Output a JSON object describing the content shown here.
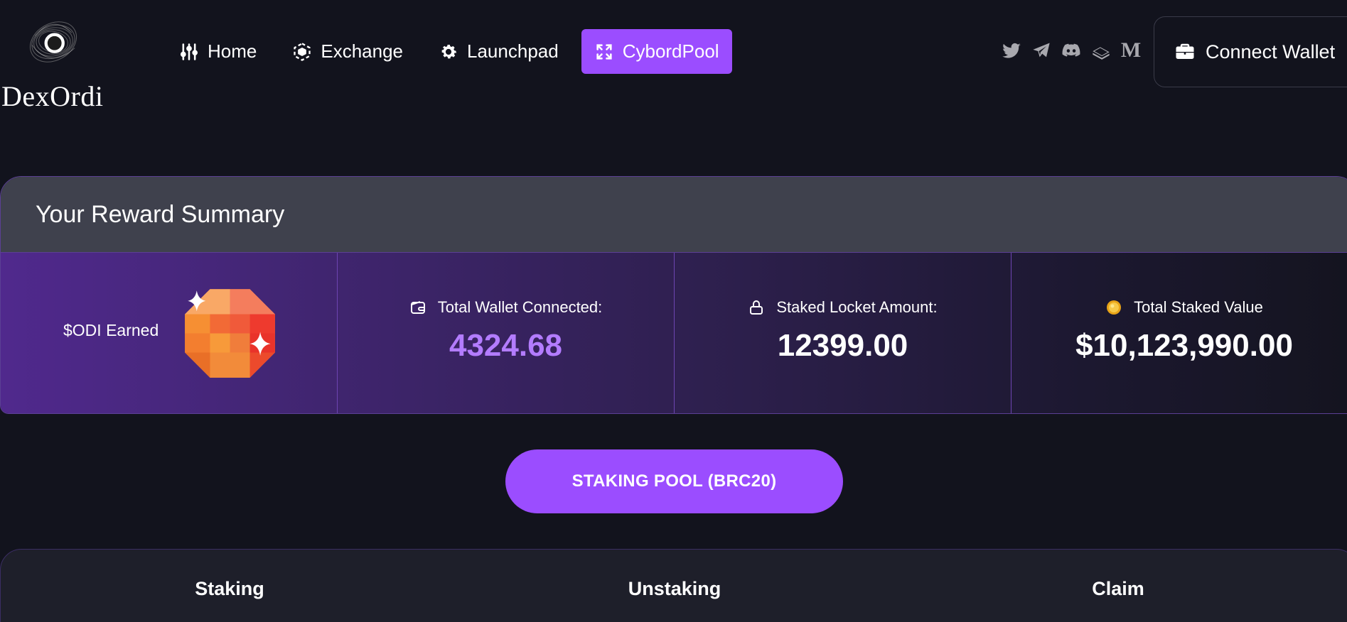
{
  "brand": {
    "name": "DexOrdi"
  },
  "nav": {
    "items": [
      {
        "label": "Home",
        "icon": "sliders-icon",
        "active": false
      },
      {
        "label": "Exchange",
        "icon": "cube-icon",
        "active": false
      },
      {
        "label": "Launchpad",
        "icon": "gear-icon",
        "active": false
      },
      {
        "label": "CybordPool",
        "icon": "expand-icon",
        "active": true
      }
    ]
  },
  "socials": [
    "twitter-icon",
    "telegram-icon",
    "discord-icon",
    "gitbook-icon",
    "medium-icon"
  ],
  "socials_medium_glyph": "M",
  "wallet": {
    "connect_label": "Connect Wallet"
  },
  "summary": {
    "title": "Your Reward Summary",
    "earned_label": "$ODI Earned",
    "stats": [
      {
        "title": "Total Wallet Connected:",
        "value": "4324.68",
        "icon": "wallet-icon"
      },
      {
        "title": "Staked Locket Amount:",
        "value": "12399.00",
        "icon": "lock-icon"
      },
      {
        "title": "Total Staked Value",
        "value": "$10,123,990.00",
        "icon": "coin-icon"
      }
    ]
  },
  "pool_button": {
    "label": "STAKING POOL (BRC20)"
  },
  "tabs": [
    "Staking",
    "Unstaking",
    "Claim"
  ],
  "colors": {
    "accent": "#9b4dff",
    "background": "#12131d",
    "highlight_value": "#b37cff",
    "card_header": "#3f414d"
  }
}
